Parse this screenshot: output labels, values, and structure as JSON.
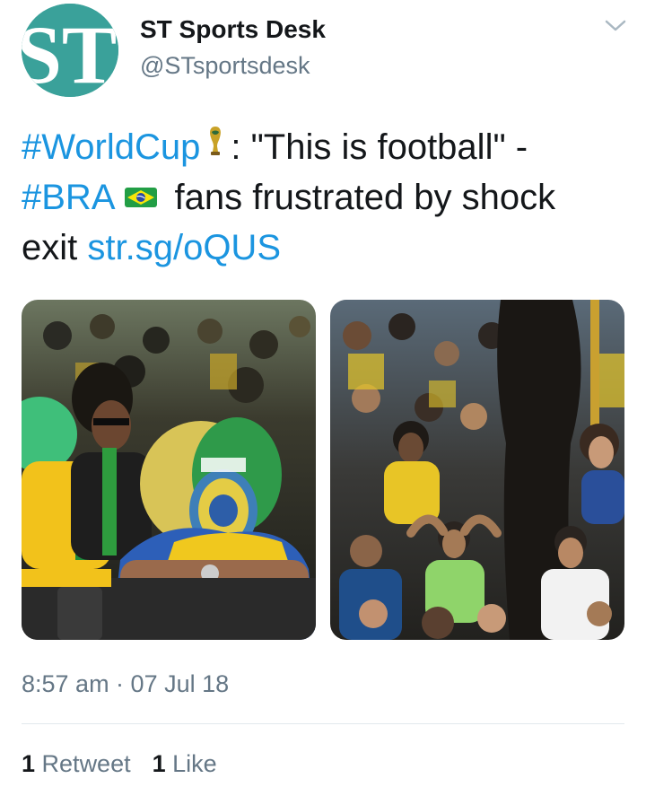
{
  "user": {
    "display_name": "ST Sports Desk",
    "handle": "@STsportsdesk",
    "avatar_initials": "ST"
  },
  "tweet": {
    "line1": {
      "hashtag": "#WorldCup",
      "emoji": "world-cup-trophy-emoji",
      "text": ": \"This is football\" -"
    },
    "line2": {
      "hashtag": "#BRA",
      "emoji": "brazil-flag-emoji",
      "text": "fans frustrated by shock"
    },
    "line3": {
      "text": "exit",
      "link": "str.sg/oQUS"
    }
  },
  "media": [
    {
      "icon": "photo-brazil-fan-face-paint"
    },
    {
      "icon": "photo-crowd-reacting"
    }
  ],
  "meta": {
    "timestamp": "8:57 am · 07 Jul 18",
    "retweets_count": "1",
    "retweets_label": "Retweet",
    "likes_count": "1",
    "likes_label": "Like"
  },
  "colors": {
    "link": "#1b95e0",
    "secondary_text": "#657786",
    "avatar_bg": "#3aa19a",
    "divider": "#e1e8ed"
  }
}
